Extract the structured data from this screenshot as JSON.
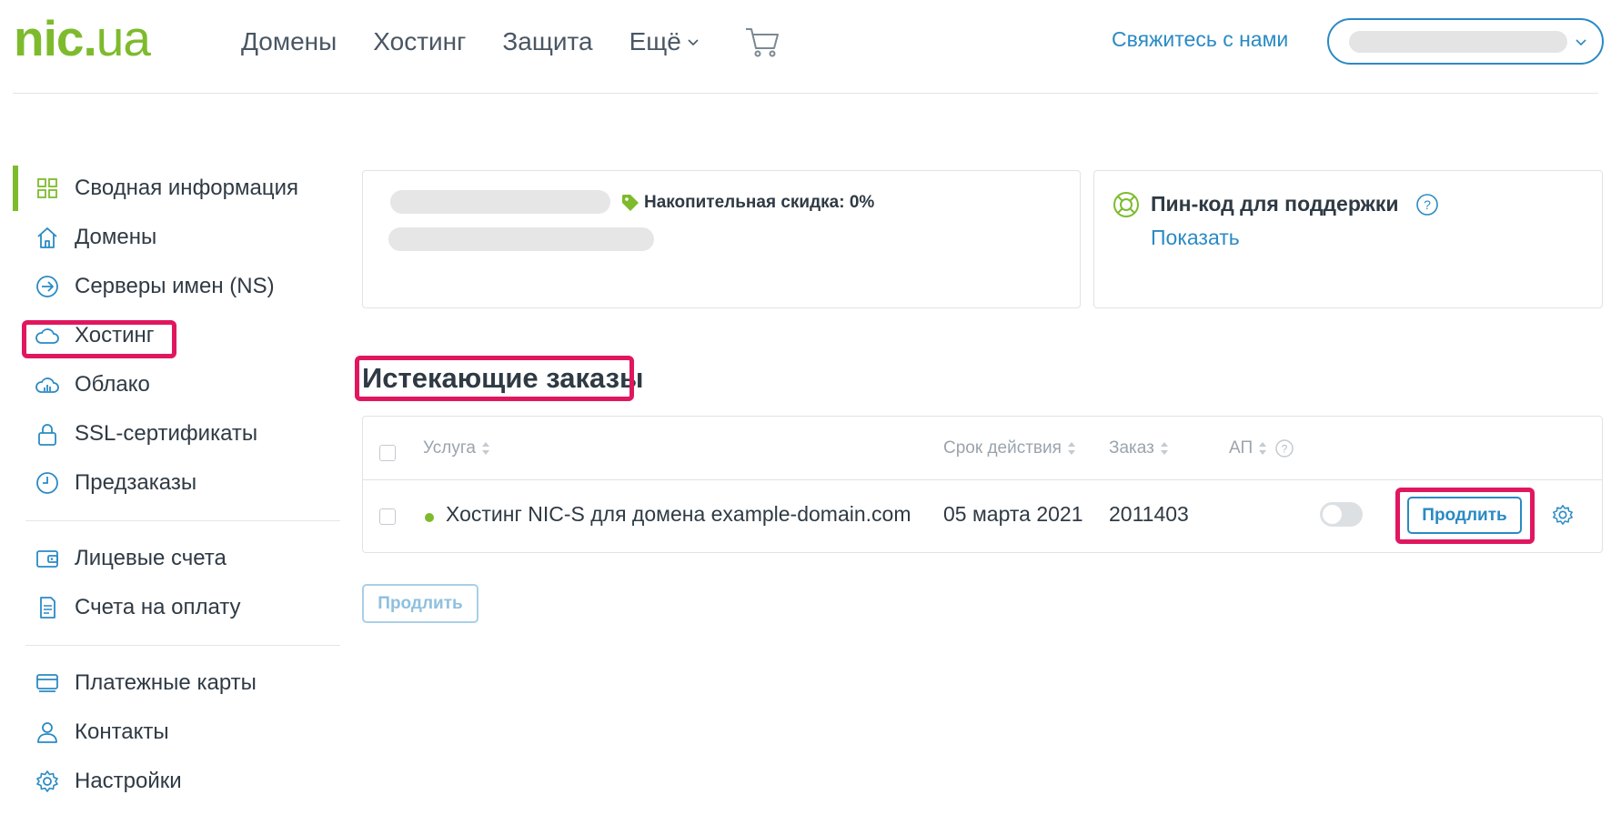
{
  "logo": {
    "text_main": "nic",
    "text_dot": ".",
    "text_ua": "ua"
  },
  "nav": {
    "items": [
      {
        "label": "Домены"
      },
      {
        "label": "Хостинг"
      },
      {
        "label": "Защита"
      },
      {
        "label": "Ещё"
      }
    ],
    "cart_icon": "cart-icon",
    "contact_label": "Свяжитесь с нами"
  },
  "sidebar": {
    "items": [
      {
        "label": "Сводная информация",
        "icon": "grid-icon"
      },
      {
        "label": "Домены",
        "icon": "home-icon"
      },
      {
        "label": "Серверы имен (NS)",
        "icon": "arrow-circle-icon"
      },
      {
        "label": "Хостинг",
        "icon": "cloud-icon"
      },
      {
        "label": "Облако",
        "icon": "cloud-chart-icon"
      },
      {
        "label": "SSL-сертификаты",
        "icon": "lock-icon"
      },
      {
        "label": "Предзаказы",
        "icon": "clock-icon"
      },
      {
        "label": "Лицевые счета",
        "icon": "wallet-icon"
      },
      {
        "label": "Счета на оплату",
        "icon": "invoice-icon"
      },
      {
        "label": "Платежные карты",
        "icon": "cards-icon"
      },
      {
        "label": "Контакты",
        "icon": "person-icon"
      },
      {
        "label": "Настройки",
        "icon": "gear-icon"
      }
    ],
    "active_index": 0
  },
  "user_card": {
    "discount_label": "Накопительная скидка: 0%"
  },
  "pin_card": {
    "title": "Пин-код для поддержки",
    "show_link": "Показать"
  },
  "orders": {
    "title": "Истекающие заказы",
    "columns": {
      "service": "Услуга",
      "expiry": "Срок действия",
      "order": "Заказ",
      "autorenew": "АП"
    },
    "rows": [
      {
        "service": "Хостинг NIC-S для домена example-domain.com",
        "expiry": "05 марта 2021",
        "order": "2011403",
        "autorenew": false,
        "action_label": "Продлить"
      }
    ],
    "bulk_action_label": "Продлить"
  },
  "colors": {
    "brand_green": "#7dbb2d",
    "link_blue": "#2a8ac4",
    "highlight": "#e0175f"
  }
}
